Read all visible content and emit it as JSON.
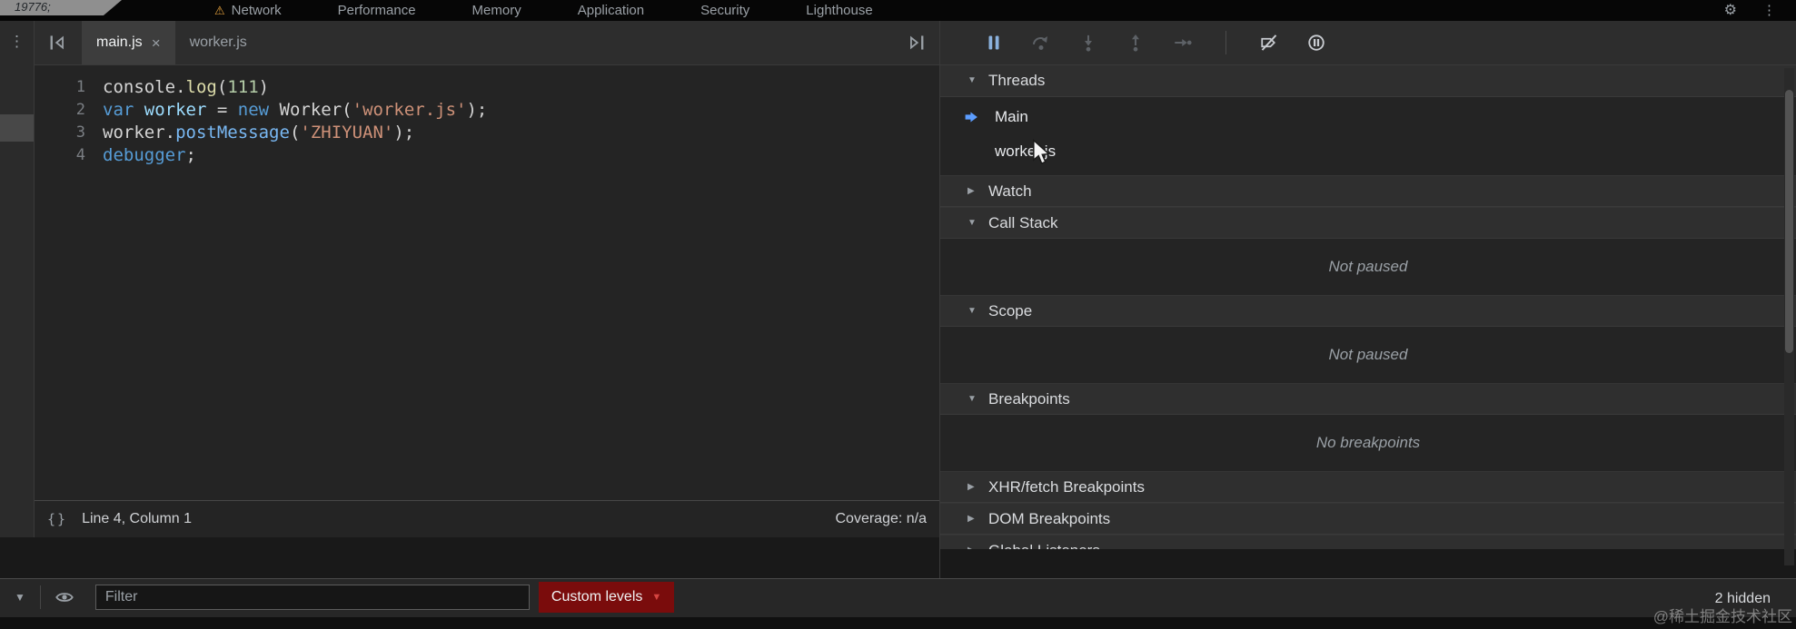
{
  "page_behind": {
    "fragment": "19776;"
  },
  "topbar": {
    "warning_icon": "⚠",
    "settings_icon": "⚙",
    "menu_icon": "⋮",
    "tabs": [
      {
        "label": "Network",
        "warning": true
      },
      {
        "label": "Performance"
      },
      {
        "label": "Memory"
      },
      {
        "label": "Application"
      },
      {
        "label": "Security"
      },
      {
        "label": "Lighthouse"
      }
    ]
  },
  "editor": {
    "strip_menu_icon": "⋮",
    "tabs": [
      {
        "label": "main.js",
        "active": true,
        "close": "×"
      },
      {
        "label": "worker.js",
        "active": false
      }
    ],
    "lines": [
      {
        "n": "1",
        "toks": [
          [
            "console",
            "pl"
          ],
          [
            ".",
            "pl"
          ],
          [
            "log",
            "fn"
          ],
          [
            "(",
            "pl"
          ],
          [
            "111",
            "num"
          ],
          [
            ")",
            "pl"
          ]
        ]
      },
      {
        "n": "2",
        "toks": [
          [
            "var",
            "kw"
          ],
          [
            " ",
            "pl"
          ],
          [
            "worker",
            "vr"
          ],
          [
            " = ",
            "pl"
          ],
          [
            "new",
            "kw"
          ],
          [
            " ",
            "pl"
          ],
          [
            "Worker",
            "pl"
          ],
          [
            "(",
            "pl"
          ],
          [
            "'worker.js'",
            "str"
          ],
          [
            ");",
            "pl"
          ]
        ]
      },
      {
        "n": "3",
        "toks": [
          [
            "worker",
            "pl"
          ],
          [
            ".",
            "pl"
          ],
          [
            "postMessage",
            "prop"
          ],
          [
            "(",
            "pl"
          ],
          [
            "'ZHIYUAN'",
            "str"
          ],
          [
            ");",
            "pl"
          ]
        ]
      },
      {
        "n": "4",
        "toks": [
          [
            "debugger",
            "kw"
          ],
          [
            ";",
            "pl"
          ]
        ]
      }
    ],
    "status": {
      "format_icon": "{}",
      "position": "Line 4, Column 1",
      "coverage": "Coverage: n/a"
    }
  },
  "debugger_pane": {
    "toolbar": [
      {
        "name": "pause",
        "enabled": true,
        "accent": true
      },
      {
        "name": "step-over",
        "enabled": false
      },
      {
        "name": "step-into",
        "enabled": false
      },
      {
        "name": "step-out",
        "enabled": false
      },
      {
        "name": "step",
        "enabled": false
      },
      {
        "name": "deactivate-breakpoints",
        "enabled": true
      },
      {
        "name": "pause-on-exceptions",
        "enabled": true
      }
    ],
    "sections": [
      {
        "title": "Threads",
        "state": "expanded",
        "rows": [
          {
            "label": "Main",
            "current": true
          },
          {
            "label": "worker.js",
            "current": false
          }
        ]
      },
      {
        "title": "Watch",
        "state": "collapsed"
      },
      {
        "title": "Call Stack",
        "state": "expanded",
        "message": "Not paused"
      },
      {
        "title": "Scope",
        "state": "expanded",
        "message": "Not paused"
      },
      {
        "title": "Breakpoints",
        "state": "expanded",
        "message": "No breakpoints"
      },
      {
        "title": "XHR/fetch Breakpoints",
        "state": "collapsed"
      },
      {
        "title": "DOM Breakpoints",
        "state": "collapsed"
      },
      {
        "title": "Global Listeners",
        "state": "collapsed",
        "clipped": true
      }
    ]
  },
  "drawer": {
    "expand_icon": "▼",
    "filter_placeholder": "Filter",
    "custom_levels": {
      "label": "Custom levels",
      "caret": "▼"
    },
    "hidden_count": "2 hidden"
  },
  "watermark": "@稀土掘金技术社区",
  "colors": {
    "accent_blue": "#5c9dff",
    "keyword_blue": "#569cd6",
    "string_orange": "#ce9178",
    "number_green": "#b5cea8",
    "custom_levels_bg": "#7a0c0c",
    "warning_orange": "#e8a33d"
  }
}
